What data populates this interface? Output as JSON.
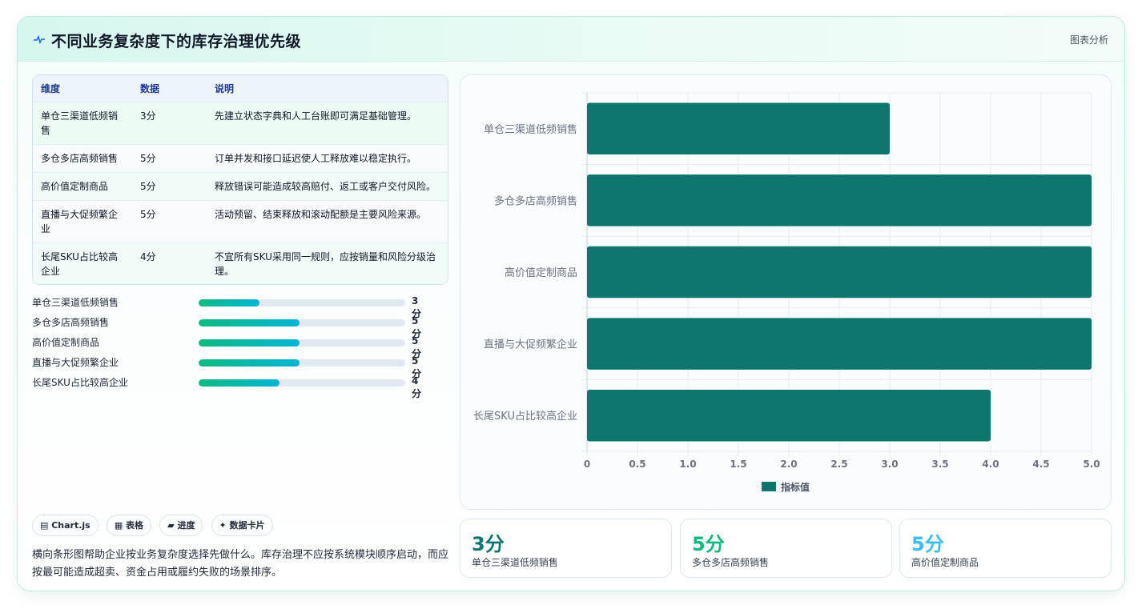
{
  "header": {
    "title": "不同业务复杂度下的库存治理优先级",
    "tag": "图表分析"
  },
  "table": {
    "headers": [
      "维度",
      "数据",
      "说明"
    ],
    "rows": [
      [
        "单仓三渠道低频销售",
        "3分",
        "先建立状态字典和人工台账即可满足基础管理。"
      ],
      [
        "多仓多店高频销售",
        "5分",
        "订单并发和接口延迟使人工释放难以稳定执行。"
      ],
      [
        "高价值定制商品",
        "5分",
        "释放错误可能造成较高赔付、返工或客户交付风险。"
      ],
      [
        "直播与大促频繁企业",
        "5分",
        "活动预留、结束释放和滚动配额是主要风险来源。"
      ],
      [
        "长尾SKU占比较高企业",
        "4分",
        "不宜所有SKU采用同一规则，应按销量和风险分级治理。"
      ]
    ]
  },
  "progress": [
    {
      "label": "单仓三渠道低频销售",
      "value_text": "3分",
      "fraction": 0.295
    },
    {
      "label": "多仓多店高频销售",
      "value_text": "5分",
      "fraction": 0.49
    },
    {
      "label": "高价值定制商品",
      "value_text": "5分",
      "fraction": 0.49
    },
    {
      "label": "直播与大促频繁企业",
      "value_text": "5分",
      "fraction": 0.49
    },
    {
      "label": "长尾SKU占比较高企业",
      "value_text": "4分",
      "fraction": 0.39
    }
  ],
  "pills": [
    "▤ Chart.js",
    "▦ 表格",
    "▰ 进度",
    "✦ 数据卡片"
  ],
  "description": "横向条形图帮助企业按业务复杂度选择先做什么。库存治理不应按系统模块顺序启动，而应按最可能造成超卖、资金占用或履约失败的场景排序。",
  "chart_data": {
    "type": "bar",
    "orientation": "horizontal",
    "categories": [
      "单仓三渠道低频销售",
      "多仓多店高频销售",
      "高价值定制商品",
      "直播与大促频繁企业",
      "长尾SKU占比较高企业"
    ],
    "series": [
      {
        "name": "指标值",
        "values": [
          3,
          5,
          5,
          5,
          4
        ]
      }
    ],
    "xlim": [
      0,
      5
    ],
    "xticks": [
      "0",
      "0.5",
      "1.0",
      "1.5",
      "2.0",
      "2.5",
      "3.0",
      "3.5",
      "4.0",
      "4.5",
      "5.0"
    ],
    "grid": true,
    "legend": "bottom",
    "bar_color": "#0f766e"
  },
  "kpis": [
    {
      "value": "3分",
      "label": "单仓三渠道低频销售",
      "color": "#0f766e"
    },
    {
      "value": "5分",
      "label": "多仓多店高频销售",
      "color": "#10b981"
    },
    {
      "value": "5分",
      "label": "高价值定制商品",
      "color": "#38bdf8"
    }
  ]
}
